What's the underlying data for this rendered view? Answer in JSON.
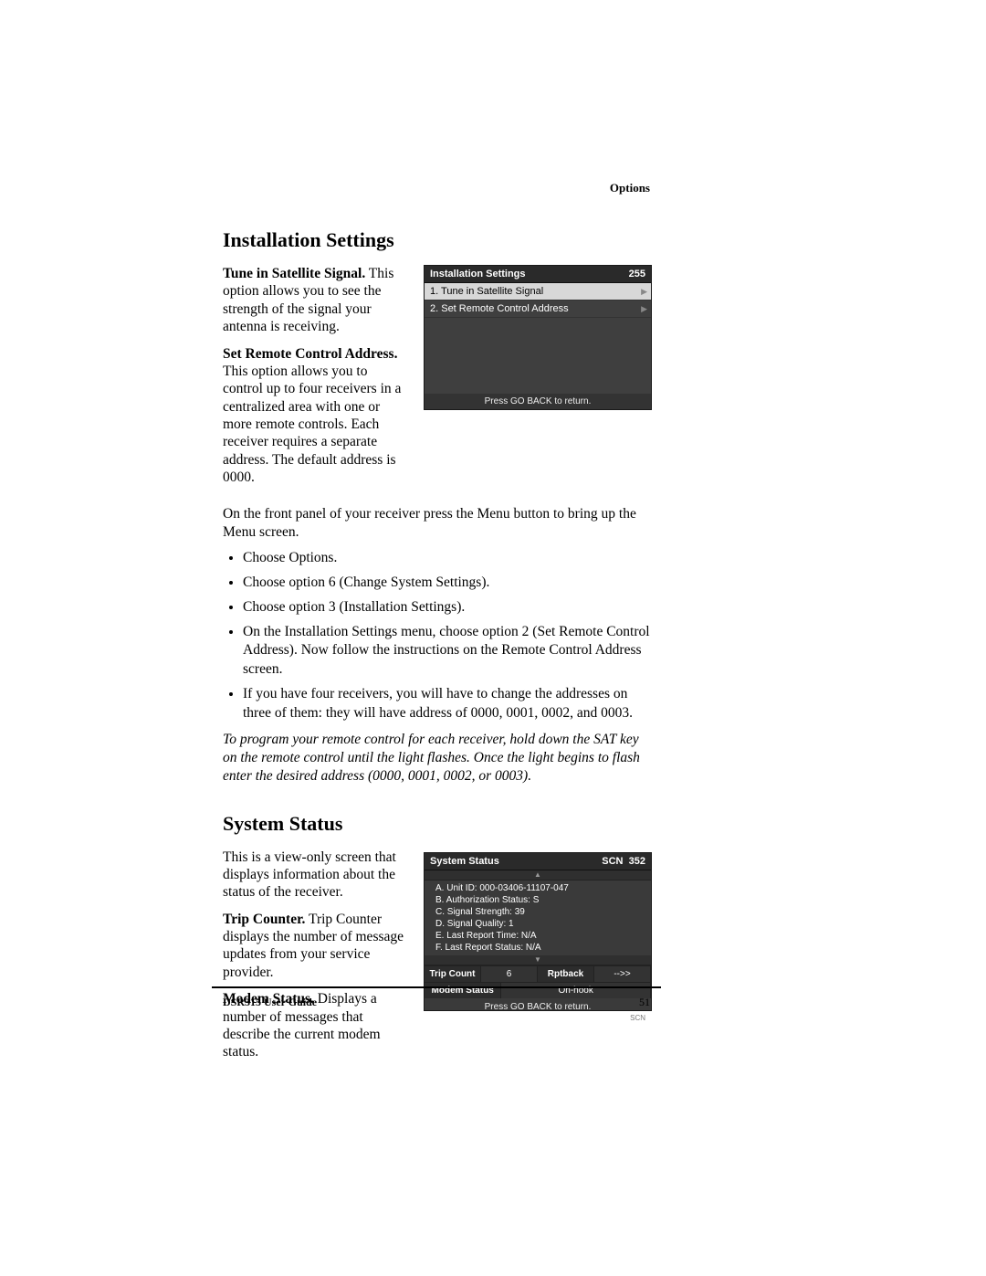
{
  "header": {
    "section": "Options"
  },
  "h1_install": "Installation Settings",
  "p_tune_label": "Tune in Satellite Signal.",
  "p_tune_text": " This option allows you to see the strength of the signal your antenna is receiving.",
  "p_remote_label": "Set Remote Control Address.",
  "p_remote_text": " This option allows you to control up to four receivers in a centralized area with one or more remote controls. Each receiver requires a separate address. The default address is 0000.",
  "osd1": {
    "title": "Installation Settings",
    "code": "255",
    "items": [
      "1.  Tune in Satellite Signal",
      "2.  Set Remote Control Address"
    ],
    "footer": "Press GO BACK to return."
  },
  "p_frontpanel": "On the front panel of your receiver press the Menu button to bring up the Menu screen.",
  "bullets": [
    "Choose Options.",
    "Choose option 6 (Change System Settings).",
    "Choose option 3 (Installation Settings).",
    "On the Installation Settings menu, choose option 2 (Set Remote Control Address). Now follow the instructions on the Remote Control Address screen.",
    "If you have four receivers, you will have to change the addresses on three of them: they will have address of 0000, 0001, 0002, and 0003."
  ],
  "italic_note": "To program your remote control for each receiver, hold down the SAT key on the remote control until the light flashes. Once the light begins to flash enter the desired address (0000, 0001, 0002, or 0003).",
  "h1_status": "System Status",
  "p_status_intro": "This is a view-only screen that displays information about the status of the receiver.",
  "p_trip_label": "Trip Counter.",
  "p_trip_text": " Trip Counter displays the number of message updates from your service provider.",
  "p_modem_label": "Modem Status.",
  "p_modem_text": " Displays a number of messages that describe the current modem status.",
  "osd2": {
    "title": "System Status",
    "scn": "SCN",
    "code": "352",
    "lines": [
      "A.  Unit ID:  000-03406-11107-047",
      "B.  Authorization Status:  S",
      "C.  Signal Strength:  39",
      "D.  Signal Quality:  1",
      "E.  Last Report Time:  N/A",
      "F.  Last Report Status:  N/A"
    ],
    "trip_label": "Trip Count",
    "trip_value": "6",
    "rpt_label": "Rptback",
    "rpt_value": "-->>",
    "modem_label": "Modem Status",
    "modem_value": "On-hook",
    "footer": "Press GO BACK to return.",
    "brand": "SCN"
  },
  "footer": {
    "guide": "DSR315 User Guide",
    "page": "51"
  }
}
